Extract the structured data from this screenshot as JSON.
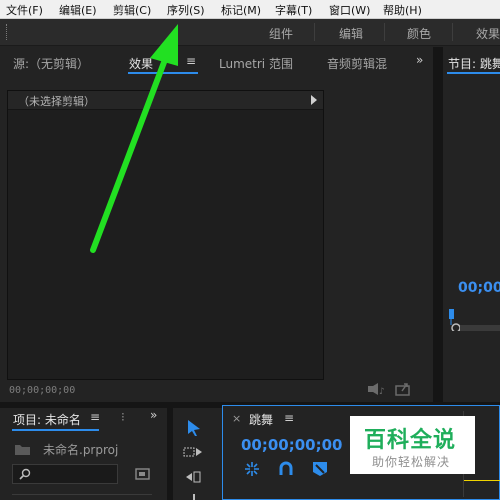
{
  "menu": [
    "文件(F)",
    "编辑(E)",
    "剪辑(C)",
    "序列(S)",
    "标记(M)",
    "字幕(T)",
    "窗口(W)",
    "帮助(H)"
  ],
  "workspace_tabs": [
    "组件",
    "编辑",
    "颜色",
    "效果"
  ],
  "source_panel": {
    "tabs": [
      "源:(无剪辑)",
      "效果控件",
      "Lumetri 范围",
      "音频剪辑混合器"
    ],
    "tab_visible_text": [
      "源:（无剪辑）",
      "效果",
      "Lumetri 范围",
      "音频剪辑混"
    ],
    "clip_selector": "（未选择剪辑）",
    "timecode": "00;00;00;00"
  },
  "program_panel": {
    "title": "节目: 跳舞",
    "title_visible": "节目: 跳舞",
    "timecode_visible": "00;00;0"
  },
  "project_panel": {
    "title": "项目: 未命名",
    "file_name": "未命名.prproj",
    "search_placeholder": ""
  },
  "timeline_panel": {
    "sequence_name": "跳舞",
    "close_glyph": "×",
    "timecode": "00;00;00;00"
  },
  "watermark": {
    "main": "百科全说",
    "sub": "助你轻松解决"
  },
  "colors": {
    "accent_blue": "#2d8ceb",
    "timecode_blue": "#3b8ff0",
    "annotation_arrow": "#22e022",
    "watermark_green": "#1fae5b"
  },
  "icons": [
    "hamburger-menu-icon",
    "panel-overflow-icon",
    "clip-selector-arrow-icon",
    "export-audio-icon",
    "export-frame-icon",
    "folder-icon",
    "search-icon",
    "new-bin-icon",
    "selection-tool-icon",
    "track-select-forward-icon",
    "ripple-edit-icon",
    "snap-icon",
    "linked-selection-icon",
    "add-marker-icon",
    "playhead-marker-icon"
  ]
}
